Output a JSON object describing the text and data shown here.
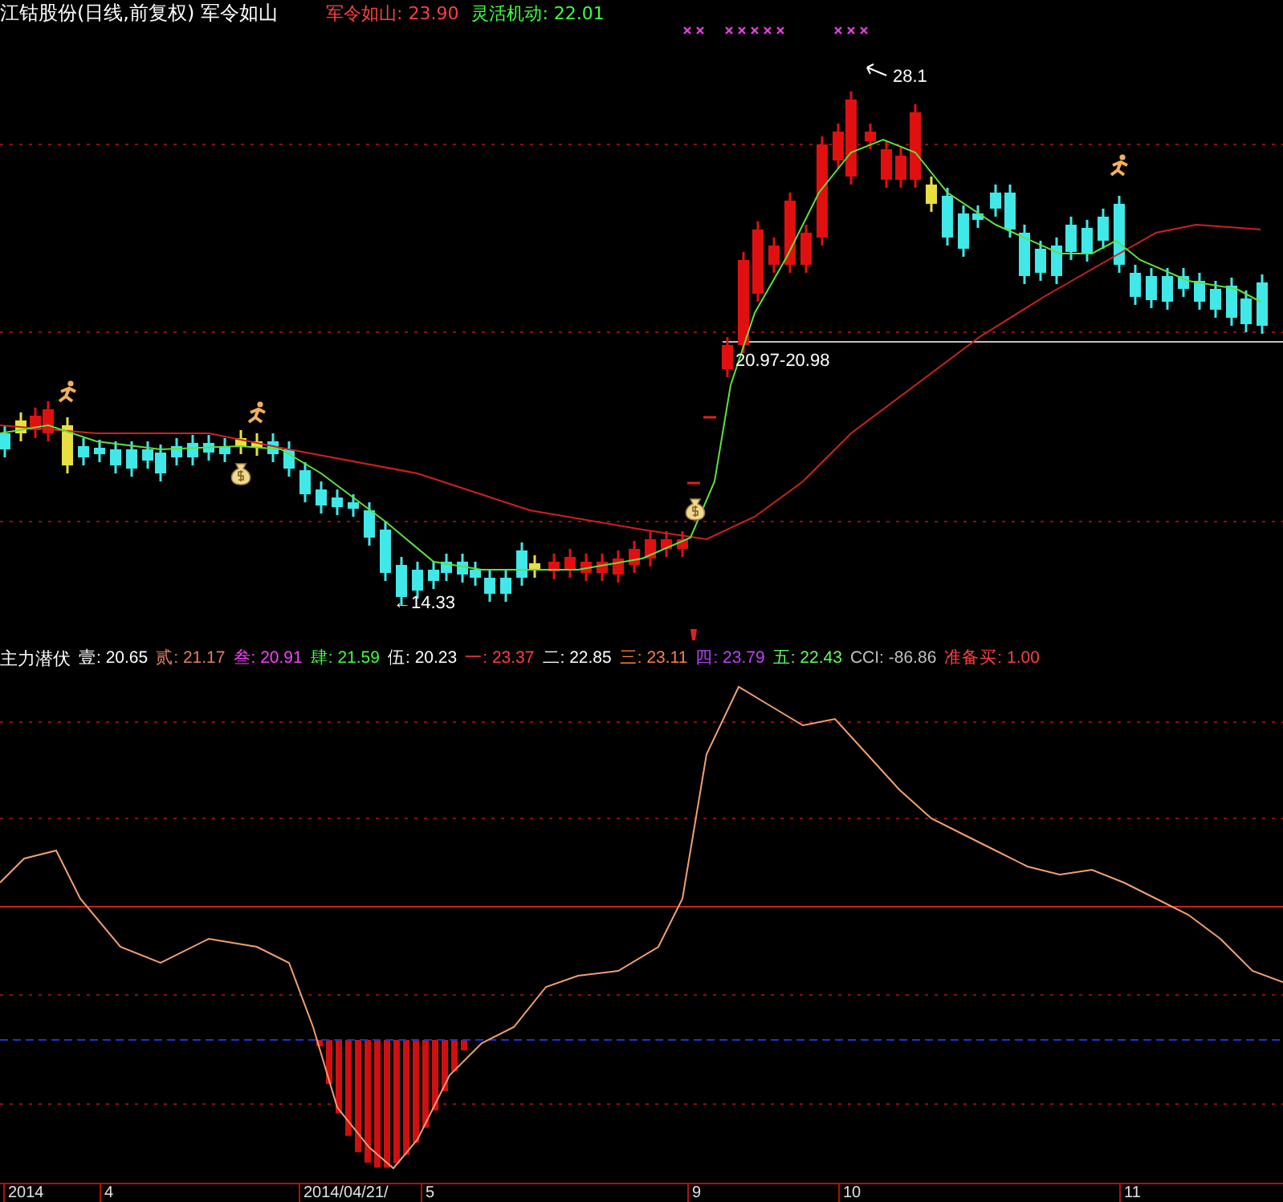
{
  "price_panel": {
    "title": "江钴股份(日线,前复权) 军令如山",
    "readings": [
      {
        "text": "军令如山: 23.90",
        "color": "#ff4040"
      },
      {
        "text": "灵活机动: 22.01",
        "color": "#40ff40"
      }
    ],
    "high_label": "28.1",
    "range_label": "20.97-20.98",
    "low_label": "←14.33"
  },
  "indicator_panel": {
    "title": "主力潜伏",
    "readings": [
      {
        "text": "壹: 20.65",
        "color": "#ffffff"
      },
      {
        "text": "贰: 21.17",
        "color": "#e08060"
      },
      {
        "text": "叁: 20.91",
        "color": "#ff40ff"
      },
      {
        "text": "肆: 21.59",
        "color": "#40ff40"
      },
      {
        "text": "伍: 20.23",
        "color": "#ffffff"
      },
      {
        "text": "一: 23.37",
        "color": "#ff4040"
      },
      {
        "text": "二: 22.85",
        "color": "#ffffff"
      },
      {
        "text": "三: 23.11",
        "color": "#ff8040"
      },
      {
        "text": "四: 23.79",
        "color": "#c040ff"
      },
      {
        "text": "五: 22.43",
        "color": "#60ff60"
      },
      {
        "text": "CCI: -86.86",
        "color": "#c0c0c0"
      },
      {
        "text": "准备买: 1.00",
        "color": "#ff4040"
      }
    ]
  },
  "x_axis": {
    "labels": [
      "2014",
      "4",
      "2014/04/21/",
      "5",
      "9",
      "10",
      "11"
    ]
  }
}
